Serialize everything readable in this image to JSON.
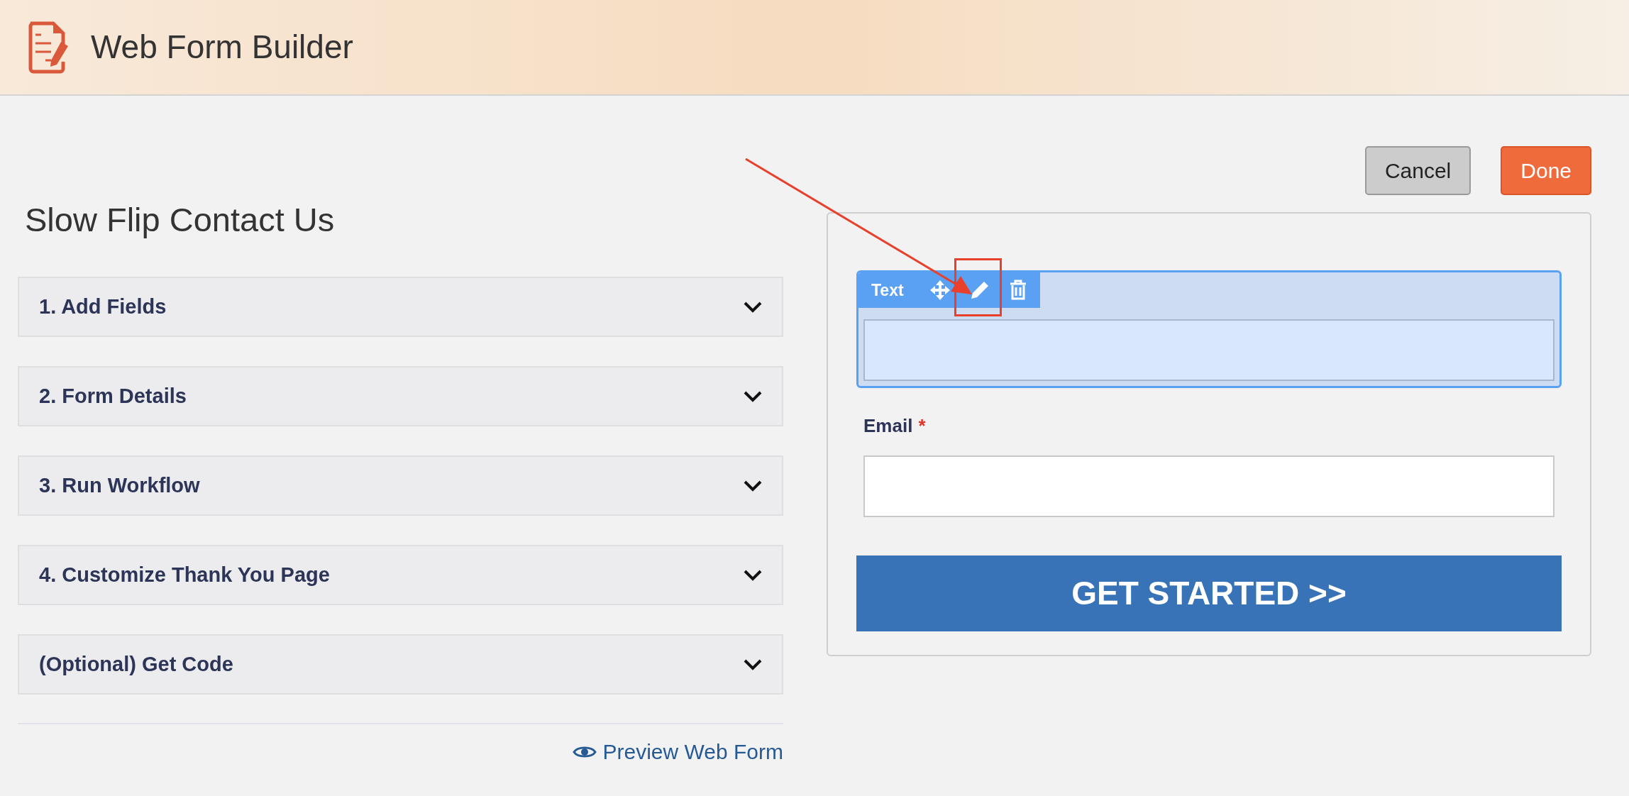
{
  "header": {
    "title": "Web Form Builder"
  },
  "actions": [
    {
      "label": "Cancel",
      "kind": "secondary"
    },
    {
      "label": "Done",
      "kind": "primary"
    }
  ],
  "form_title": "Slow Flip Contact Us",
  "sections": [
    {
      "label": "1. Add Fields",
      "expanded": false
    },
    {
      "label": "2. Form Details",
      "expanded": false
    },
    {
      "label": "3. Run Workflow",
      "expanded": false
    },
    {
      "label": "4. Customize Thank You Page",
      "expanded": false
    },
    {
      "label": "(Optional) Get Code",
      "expanded": false
    }
  ],
  "preview_link": "Preview Web Form",
  "form_preview": {
    "fields": [
      {
        "kind": "text",
        "type_label": "Text",
        "selected": true
      },
      {
        "kind": "email",
        "label": "Email",
        "required": true,
        "required_mark": "*",
        "selected": false
      }
    ],
    "submit_button": "GET STARTED >>"
  }
}
